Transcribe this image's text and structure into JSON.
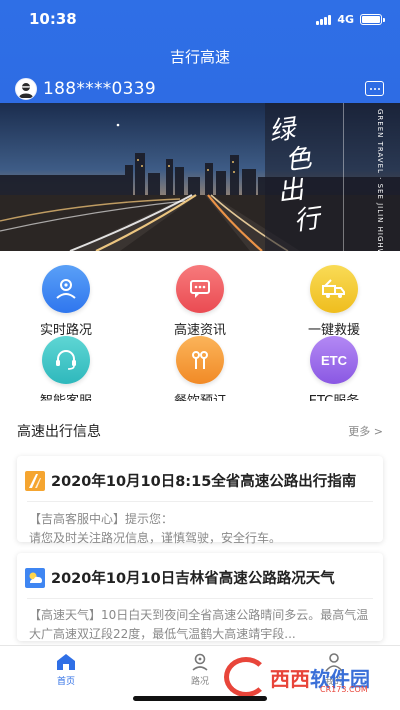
{
  "status": {
    "time": "10:38",
    "network": "4G"
  },
  "app": {
    "title": "吉行高速"
  },
  "user": {
    "phone": "188****0339"
  },
  "banner": {
    "chars": [
      "绿",
      "色",
      "出",
      "行"
    ],
    "english": "GREEN TRAVEL · SEE JILIN HIGHWAY"
  },
  "services": [
    {
      "label": "实时路况",
      "icon": "traffic-icon",
      "color": "#3f86f2"
    },
    {
      "label": "高速资讯",
      "icon": "news-icon",
      "color": "#f0575c"
    },
    {
      "label": "一键救援",
      "icon": "tow-truck-icon",
      "color": "#f3c72f"
    },
    {
      "label": "智能客服",
      "icon": "headset-icon",
      "color": "#3fc5c7"
    },
    {
      "label": "餐饮预订",
      "icon": "utensils-icon",
      "color": "#f59a35"
    },
    {
      "label": "ETC服务",
      "icon": "etc-icon",
      "color": "#9a6ae8",
      "text": "ETC"
    }
  ],
  "section": {
    "title": "高速出行信息",
    "more": "更多 >"
  },
  "cards": [
    {
      "title": "2020年10月10日8:15全省高速公路出行指南",
      "icon": "road-icon",
      "body": "【吉高客服中心】提示您：\n请您及时关注路况信息，谨慎驾驶，安全行车。"
    },
    {
      "title": "2020年10月10日吉林省高速公路路况天气",
      "icon": "weather-icon",
      "body": "【高速天气】10日白天到夜间全省高速公路晴间多云。最高气温大广高速双辽段22度，最低气温鹤大高速靖宇段..."
    }
  ],
  "tabs": [
    {
      "label": "首页",
      "active": true,
      "icon": "home-icon"
    },
    {
      "label": "路况",
      "active": false,
      "icon": "location-icon"
    },
    {
      "label": "我的",
      "active": false,
      "icon": "user-icon"
    }
  ],
  "watermark": {
    "brand": "西西",
    "brand2": "软件园",
    "url": "CR173.COM"
  },
  "colors": {
    "brand": "#2f6fe6"
  }
}
